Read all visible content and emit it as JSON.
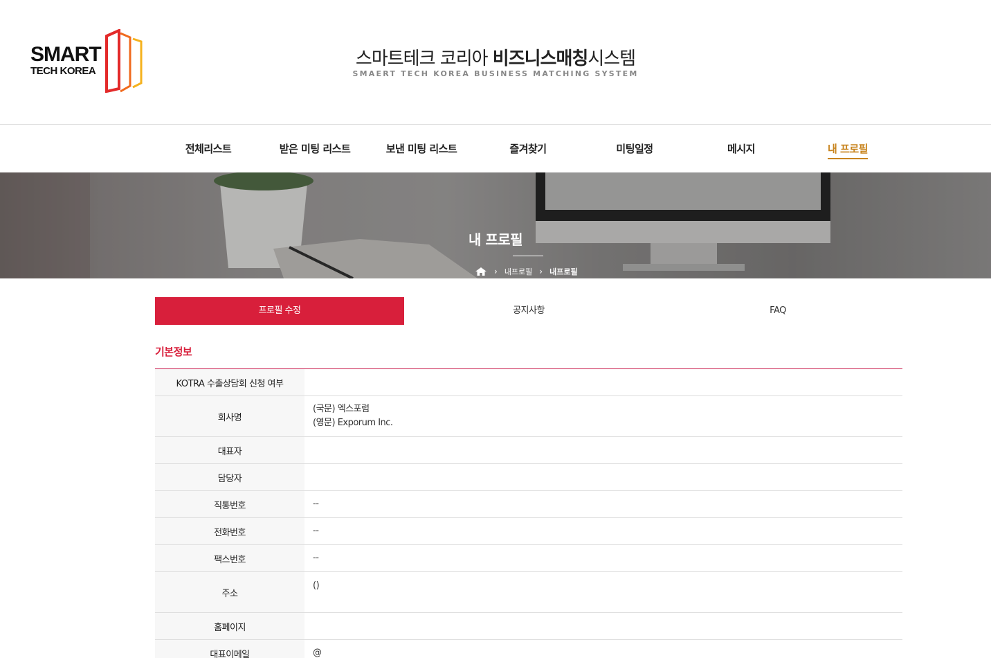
{
  "logo": {
    "line1": "SMART",
    "line2": "TECH KOREA"
  },
  "header": {
    "title_normal": "스마트테크 코리아 ",
    "title_bold": "비즈니스매칭",
    "title_end": "시스템",
    "subtitle": "SMAERT TECH KOREA BUSINESS MATCHING SYSTEM"
  },
  "nav": {
    "items": [
      "전체리스트",
      "받은 미팅 리스트",
      "보낸 미팅 리스트",
      "즐겨찾기",
      "미팅일정",
      "메시지",
      "내 프로필"
    ],
    "active_index": 6,
    "active_color": "#c8841e"
  },
  "banner": {
    "title": "내 프로필",
    "breadcrumb": [
      "내프로필",
      "내프로필"
    ],
    "home_icon": "home-icon"
  },
  "tabs": {
    "items": [
      "프로필 수정",
      "공지사항",
      "FAQ"
    ],
    "active_index": 0,
    "active_color": "#d81f3b"
  },
  "section": {
    "title": "기본정보",
    "rows": [
      {
        "label": "KOTRA 수출상담회 신청 여부",
        "values": [
          ""
        ]
      },
      {
        "label": "회사명",
        "values": [
          "(국문) 엑스포럼",
          "(영문) Exporum Inc."
        ]
      },
      {
        "label": "대표자",
        "values": [
          ""
        ]
      },
      {
        "label": "담당자",
        "values": [
          ""
        ]
      },
      {
        "label": "직통번호",
        "values": [
          "--"
        ]
      },
      {
        "label": "전화번호",
        "values": [
          "--"
        ]
      },
      {
        "label": "팩스번호",
        "values": [
          "--"
        ]
      },
      {
        "label": "주소",
        "values": [
          "()"
        ]
      },
      {
        "label": "홈페이지",
        "values": [
          ""
        ]
      },
      {
        "label": "대표이메일",
        "values": [
          "@"
        ]
      }
    ]
  }
}
